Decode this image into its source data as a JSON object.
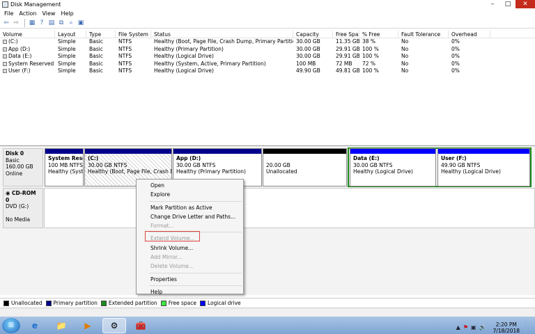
{
  "window": {
    "title": "Disk Management",
    "minimize": "–",
    "maximize": "□",
    "close": "✕"
  },
  "menu": [
    "File",
    "Action",
    "View",
    "Help"
  ],
  "toolbar": {
    "icons": [
      "back-icon",
      "forward-icon",
      "console-tree-icon",
      "help-icon",
      "properties-icon",
      "refresh-icon",
      "rescan-icon",
      "disk-options-icon"
    ],
    "glyphs": [
      "⇦",
      "⇨",
      "▦",
      "?",
      "▤",
      "⧉",
      "⌕",
      "▣"
    ]
  },
  "volume_table": {
    "headers": [
      "Volume",
      "Layout",
      "Type",
      "File System",
      "Status",
      "Capacity",
      "Free Spa...",
      "% Free",
      "Fault Tolerance",
      "Overhead"
    ],
    "rows": [
      [
        "(C:)",
        "Simple",
        "Basic",
        "NTFS",
        "Healthy (Boot, Page File, Crash Dump, Primary Partition)",
        "30.00 GB",
        "11.35 GB",
        "38 %",
        "No",
        "0%"
      ],
      [
        "App (D:)",
        "Simple",
        "Basic",
        "NTFS",
        "Healthy (Primary Partition)",
        "30.00 GB",
        "29.91 GB",
        "100 %",
        "No",
        "0%"
      ],
      [
        "Data (E:)",
        "Simple",
        "Basic",
        "NTFS",
        "Healthy (Logical Drive)",
        "30.00 GB",
        "29.91 GB",
        "100 %",
        "No",
        "0%"
      ],
      [
        "System Reserved",
        "Simple",
        "Basic",
        "NTFS",
        "Healthy (System, Active, Primary Partition)",
        "100 MB",
        "72 MB",
        "72 %",
        "No",
        "0%"
      ],
      [
        "User (F:)",
        "Simple",
        "Basic",
        "NTFS",
        "Healthy (Logical Drive)",
        "49.90 GB",
        "49.81 GB",
        "100 %",
        "No",
        "0%"
      ]
    ]
  },
  "disk0": {
    "name": "Disk 0",
    "type": "Basic",
    "size": "160.00 GB",
    "status": "Online",
    "partitions": [
      {
        "name": "System Reser",
        "size": "100 MB NTFS",
        "status": "Healthy (Syster"
      },
      {
        "name": "(C:)",
        "size": "30.00 GB NTFS",
        "status": "Healthy (Boot, Page File, Crash Dump"
      },
      {
        "name": "App  (D:)",
        "size": "30.00 GB NTFS",
        "status": "Healthy (Primary Partition)"
      },
      {
        "name": "",
        "size": "20.00 GB",
        "status": "Unallocated"
      },
      {
        "name": "Data  (E:)",
        "size": "30.00 GB NTFS",
        "status": "Healthy (Logical Drive)"
      },
      {
        "name": "User  (F:)",
        "size": "49.90 GB NTFS",
        "status": "Healthy (Logical Drive)"
      }
    ]
  },
  "cdrom0": {
    "name": "CD-ROM 0",
    "type": "DVD (G:)",
    "media": "No Media"
  },
  "context_menu": {
    "open": "Open",
    "explore": "Explore",
    "mark_active": "Mark Partition as Active",
    "change_letter": "Change Drive Letter and Paths...",
    "format": "Format...",
    "extend": "Extend Volume...",
    "shrink": "Shrink Volume...",
    "add_mirror": "Add Mirror...",
    "delete": "Delete Volume...",
    "properties": "Properties",
    "help": "Help"
  },
  "legend": [
    {
      "label": "Unallocated",
      "color": "#000000"
    },
    {
      "label": "Primary partition",
      "color": "#00008b"
    },
    {
      "label": "Extended partition",
      "color": "#1c8a1c"
    },
    {
      "label": "Free space",
      "color": "#3ee63e"
    },
    {
      "label": "Logical drive",
      "color": "#0000ff"
    }
  ],
  "taskbar": {
    "apps": [
      "ie-icon",
      "explorer-icon",
      "media-player-icon",
      "disk-management-icon",
      "toolbox-icon"
    ],
    "glyphs": [
      "e",
      "📁",
      "▶",
      "⚙",
      "🧰"
    ],
    "tray_glyphs": [
      "▲",
      "⚑",
      "▣",
      "🔊"
    ],
    "time": "2:20 PM",
    "date": "7/18/2018"
  }
}
